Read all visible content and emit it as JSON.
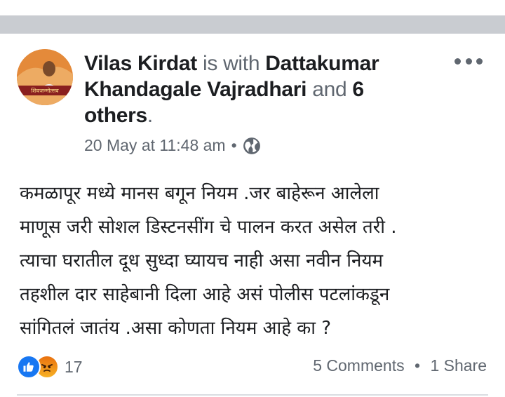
{
  "post": {
    "author": "Vilas Kirdat",
    "with_text": "is with",
    "tagged": "Dattakumar Khandagale Vajradhari",
    "and_text": "and",
    "others": "6 others",
    "period": ".",
    "timestamp": "20 May at 11:48 am",
    "separator": "•",
    "privacy_icon": "globe-icon",
    "avatar_banner": "शिवजन्मोत्सव",
    "body_lines": [
      "कमळापूर मध्ये मानस बगून नियम .जर बाहेरून आलेला",
      "माणूस जरी सोशल डिस्टनसींग चे पालन करत असेल तरी .",
      "त्याचा घरातील दूध सुध्दा घ्यायच नाही असा नवीन नियम",
      "तहशील दार साहेबानी दिला आहे असं पोलीस पटलांकडून",
      "सांगितलं जातंय .असा कोणता नियम आहे का ?"
    ]
  },
  "reactions": {
    "icons": [
      "like-icon",
      "angry-icon"
    ],
    "count": "17",
    "comments": "5 Comments",
    "separator": "•",
    "shares": "1 Share"
  },
  "colors": {
    "like": "#1877f2",
    "angry": "#f7b125",
    "secondary_text": "#606770",
    "top_bar": "#c9ccd1"
  }
}
